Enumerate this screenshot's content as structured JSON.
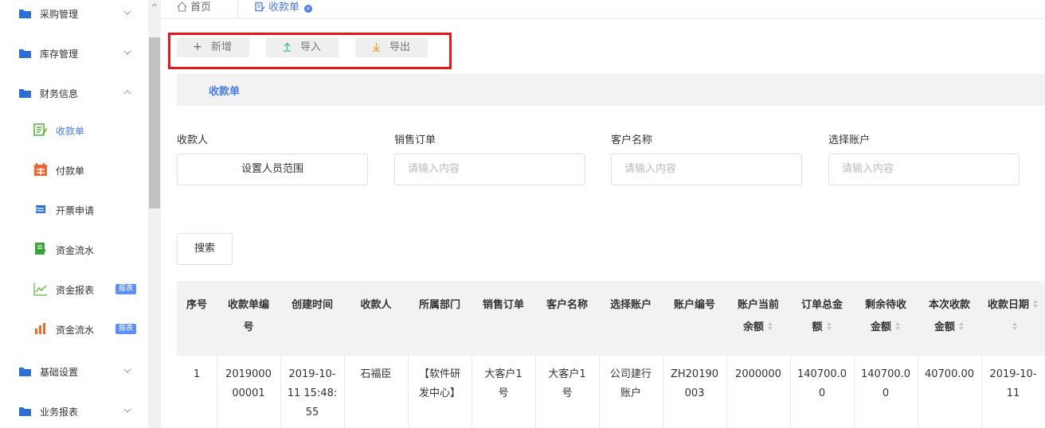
{
  "sidebar": {
    "groups": [
      {
        "label": "采购管理"
      },
      {
        "label": "库存管理"
      },
      {
        "label": "财务信息"
      },
      {
        "label": "基础设置"
      },
      {
        "label": "业务报表"
      }
    ],
    "sub_items": [
      {
        "label": "收款单",
        "active": true
      },
      {
        "label": "付款单"
      },
      {
        "label": "开票申请"
      },
      {
        "label": "资金流水"
      },
      {
        "label": "资金报表",
        "badge": "报表"
      },
      {
        "label": "资金流水",
        "badge": "报表"
      }
    ]
  },
  "tabs": {
    "home": "首页",
    "active": "收款单"
  },
  "toolbar": {
    "add": "新增",
    "import": "导入",
    "export": "导出"
  },
  "section_title": "收款单",
  "filters": {
    "payee_label": "收款人",
    "payee_button": "设置人员范围",
    "order_label": "销售订单",
    "order_placeholder": "请输入内容",
    "customer_label": "客户名称",
    "customer_placeholder": "请输入内容",
    "account_label": "选择账户",
    "account_placeholder": "请输入内容"
  },
  "search_label": "搜索",
  "table": {
    "headers": [
      [
        "序号"
      ],
      [
        "收款单编",
        "号"
      ],
      [
        "创建时间"
      ],
      [
        "收款人"
      ],
      [
        "所属部门"
      ],
      [
        "销售订单"
      ],
      [
        "客户名称"
      ],
      [
        "选择账户"
      ],
      [
        "账户编号"
      ],
      [
        "账户当前",
        "余额"
      ],
      [
        "订单总金",
        "额"
      ],
      [
        "剩余待收",
        "金额"
      ],
      [
        "本次收款",
        "金额"
      ],
      [
        "收款日期"
      ]
    ],
    "rows": [
      [
        [
          "1"
        ],
        [
          "2019000",
          "00001"
        ],
        [
          "2019-10-",
          "11 15:48:",
          "55"
        ],
        [
          "石福臣"
        ],
        [
          "【软件研",
          "发中心】"
        ],
        [
          "大客户1",
          "号"
        ],
        [
          "大客户1",
          "号"
        ],
        [
          "公司建行",
          "账户"
        ],
        [
          "ZH20190",
          "003"
        ],
        [
          "2000000"
        ],
        [
          "140700.0",
          "0"
        ],
        [
          "140700.0",
          "0"
        ],
        [
          "40700.00"
        ],
        [
          "2019-10-",
          "11"
        ]
      ]
    ]
  },
  "colors": {
    "accent": "#4a7cf0",
    "highlight_box": "#e5191c",
    "badge": "#5b8ff9"
  }
}
